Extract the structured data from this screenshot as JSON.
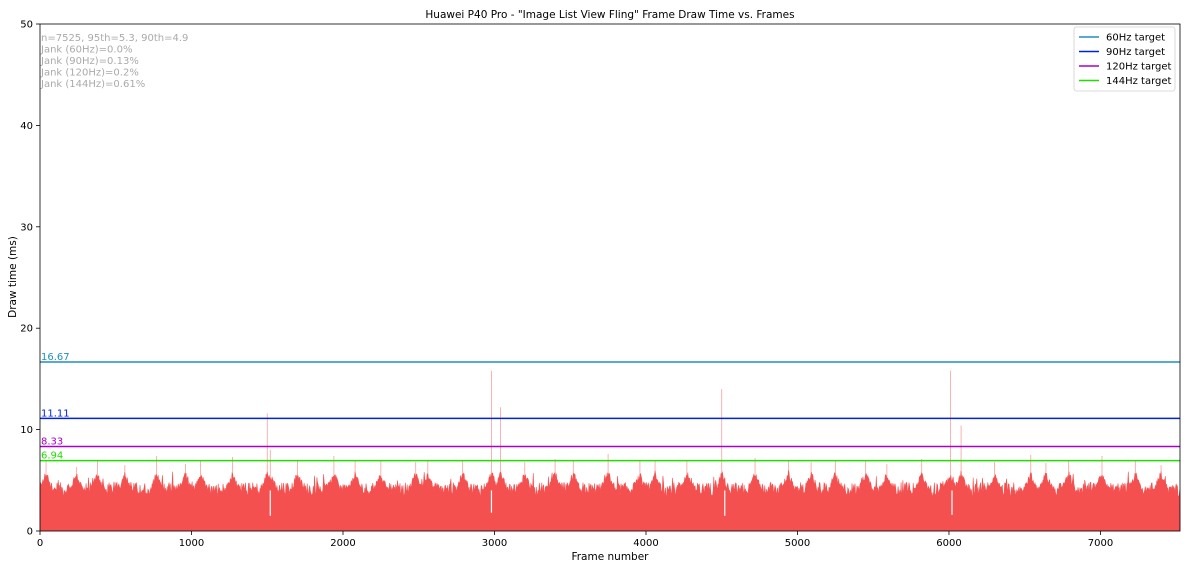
{
  "chart_data": {
    "type": "area",
    "title": "Huawei P40 Pro - \"Image List View Fling\" Frame Draw Time vs. Frames",
    "xlabel": "Frame number",
    "ylabel": "Draw time (ms)",
    "xlim": [
      0,
      7525
    ],
    "ylim": [
      0,
      50
    ],
    "xticks": [
      0,
      1000,
      2000,
      3000,
      4000,
      5000,
      6000,
      7000
    ],
    "yticks": [
      0,
      10,
      20,
      30,
      40,
      50
    ],
    "grid": false,
    "legend_position": "top-right",
    "series_color": "#f45050",
    "frame_count": 7525,
    "typical_draw_time_range": [
      3,
      5
    ],
    "spikes": [
      {
        "x": 40,
        "y": 7.0
      },
      {
        "x": 240,
        "y": 6.3
      },
      {
        "x": 380,
        "y": 7.0
      },
      {
        "x": 560,
        "y": 6.5
      },
      {
        "x": 770,
        "y": 7.4
      },
      {
        "x": 960,
        "y": 6.6
      },
      {
        "x": 1060,
        "y": 7.0
      },
      {
        "x": 1270,
        "y": 7.3
      },
      {
        "x": 1500,
        "y": 11.6
      },
      {
        "x": 1520,
        "y": 8.0
      },
      {
        "x": 1700,
        "y": 7.0
      },
      {
        "x": 1940,
        "y": 7.4
      },
      {
        "x": 2080,
        "y": 6.9
      },
      {
        "x": 2250,
        "y": 7.0
      },
      {
        "x": 2480,
        "y": 6.8
      },
      {
        "x": 2560,
        "y": 7.0
      },
      {
        "x": 2790,
        "y": 7.0
      },
      {
        "x": 2980,
        "y": 15.8
      },
      {
        "x": 3040,
        "y": 12.2
      },
      {
        "x": 3200,
        "y": 6.8
      },
      {
        "x": 3400,
        "y": 7.1
      },
      {
        "x": 3520,
        "y": 6.9
      },
      {
        "x": 3750,
        "y": 7.6
      },
      {
        "x": 3960,
        "y": 7.0
      },
      {
        "x": 4060,
        "y": 7.0
      },
      {
        "x": 4270,
        "y": 6.9
      },
      {
        "x": 4500,
        "y": 14.0
      },
      {
        "x": 4720,
        "y": 7.2
      },
      {
        "x": 4940,
        "y": 7.0
      },
      {
        "x": 5090,
        "y": 6.8
      },
      {
        "x": 5250,
        "y": 7.0
      },
      {
        "x": 5450,
        "y": 6.9
      },
      {
        "x": 5590,
        "y": 6.6
      },
      {
        "x": 5820,
        "y": 7.1
      },
      {
        "x": 6010,
        "y": 15.8
      },
      {
        "x": 6080,
        "y": 10.4
      },
      {
        "x": 6300,
        "y": 6.8
      },
      {
        "x": 6540,
        "y": 7.5
      },
      {
        "x": 6640,
        "y": 6.7
      },
      {
        "x": 6790,
        "y": 7.0
      },
      {
        "x": 7010,
        "y": 7.4
      },
      {
        "x": 7230,
        "y": 6.9
      },
      {
        "x": 7400,
        "y": 6.5
      }
    ],
    "dips": [
      {
        "x": 1520,
        "y": 1.5
      },
      {
        "x": 2980,
        "y": 1.8
      },
      {
        "x": 4520,
        "y": 1.5
      },
      {
        "x": 6020,
        "y": 1.6
      }
    ],
    "reference_lines": [
      {
        "name": "60Hz target",
        "value": 16.67,
        "label": "16.67",
        "color": "#1f8fbf"
      },
      {
        "name": "90Hz target",
        "value": 11.11,
        "label": "11.11",
        "color": "#0022dd"
      },
      {
        "name": "120Hz target",
        "value": 8.33,
        "label": "8.33",
        "color": "#aa00cc"
      },
      {
        "name": "144Hz target",
        "value": 6.94,
        "label": "6.94",
        "color": "#22dd00"
      }
    ],
    "annotations": [
      "n=7525, 95th=5.3, 90th=4.9",
      "Jank (60Hz)=0.0%",
      "Jank (90Hz)=0.13%",
      "Jank (120Hz)=0.2%",
      "Jank (144Hz)=0.61%"
    ]
  }
}
